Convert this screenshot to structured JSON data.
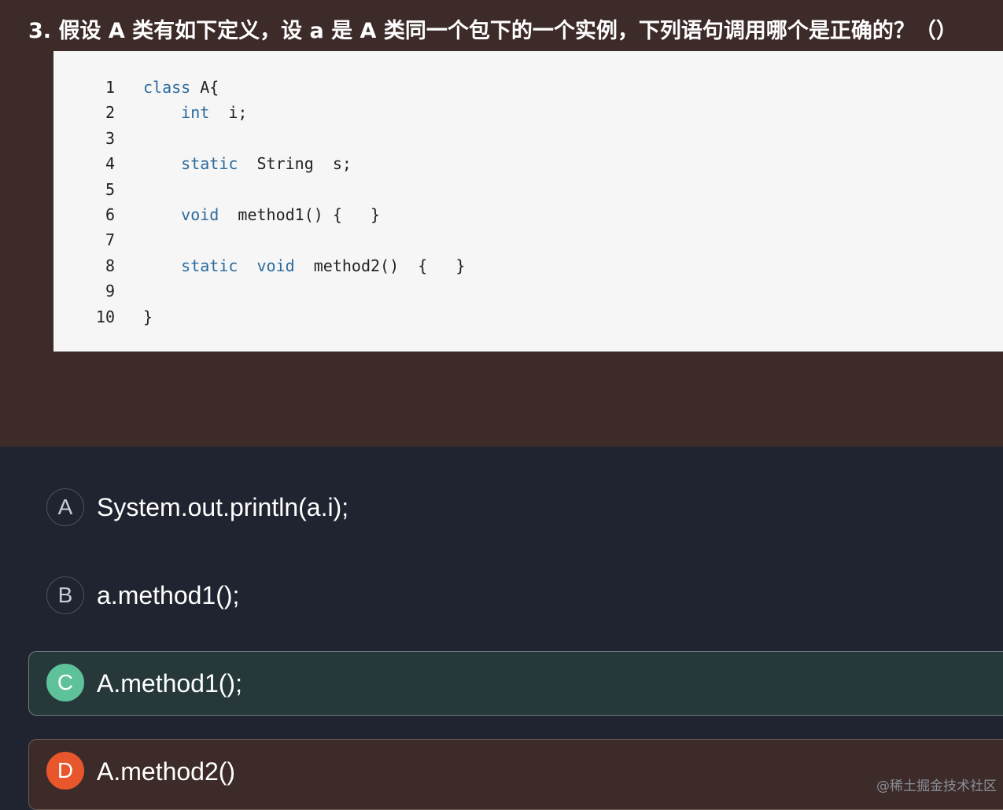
{
  "question": {
    "text": "3. 假设 A 类有如下定义，设 a 是 A 类同一个包下的一个实例，下列语句调用哪个是正确的？（）"
  },
  "code": {
    "lines": [
      {
        "num": "1",
        "parts": [
          {
            "t": "class",
            "kw": true
          },
          {
            "t": " A{",
            "kw": false
          }
        ]
      },
      {
        "num": "2",
        "parts": [
          {
            "t": "    ",
            "kw": false
          },
          {
            "t": "int",
            "kw": true
          },
          {
            "t": "  i;",
            "kw": false
          }
        ]
      },
      {
        "num": "3",
        "parts": []
      },
      {
        "num": "4",
        "parts": [
          {
            "t": "    ",
            "kw": false
          },
          {
            "t": "static",
            "kw": true
          },
          {
            "t": "  String  s;",
            "kw": false
          }
        ]
      },
      {
        "num": "5",
        "parts": []
      },
      {
        "num": "6",
        "parts": [
          {
            "t": "    ",
            "kw": false
          },
          {
            "t": "void",
            "kw": true
          },
          {
            "t": "  method1() {   }",
            "kw": false
          }
        ]
      },
      {
        "num": "7",
        "parts": []
      },
      {
        "num": "8",
        "parts": [
          {
            "t": "    ",
            "kw": false
          },
          {
            "t": "static",
            "kw": true
          },
          {
            "t": "  ",
            "kw": false
          },
          {
            "t": "void",
            "kw": true
          },
          {
            "t": "  method2()  {   }",
            "kw": false
          }
        ]
      },
      {
        "num": "9",
        "parts": []
      },
      {
        "num": "10",
        "parts": [
          {
            "t": "}",
            "kw": false
          }
        ]
      }
    ]
  },
  "options": [
    {
      "letter": "A",
      "text": "System.out.println(a.i);",
      "state": "normal"
    },
    {
      "letter": "B",
      "text": "a.method1();",
      "state": "normal"
    },
    {
      "letter": "C",
      "text": "A.method1();",
      "state": "correct"
    },
    {
      "letter": "D",
      "text": "A.method2()",
      "state": "wrong"
    }
  ],
  "watermark": "@稀土掘金技术社区",
  "colors": {
    "top_bg": "#3d2b29",
    "bottom_bg": "#1f2430",
    "code_bg": "#f6f6f6",
    "keyword": "#2b6b9e",
    "correct": "#5dc29a",
    "wrong": "#e8562c"
  }
}
